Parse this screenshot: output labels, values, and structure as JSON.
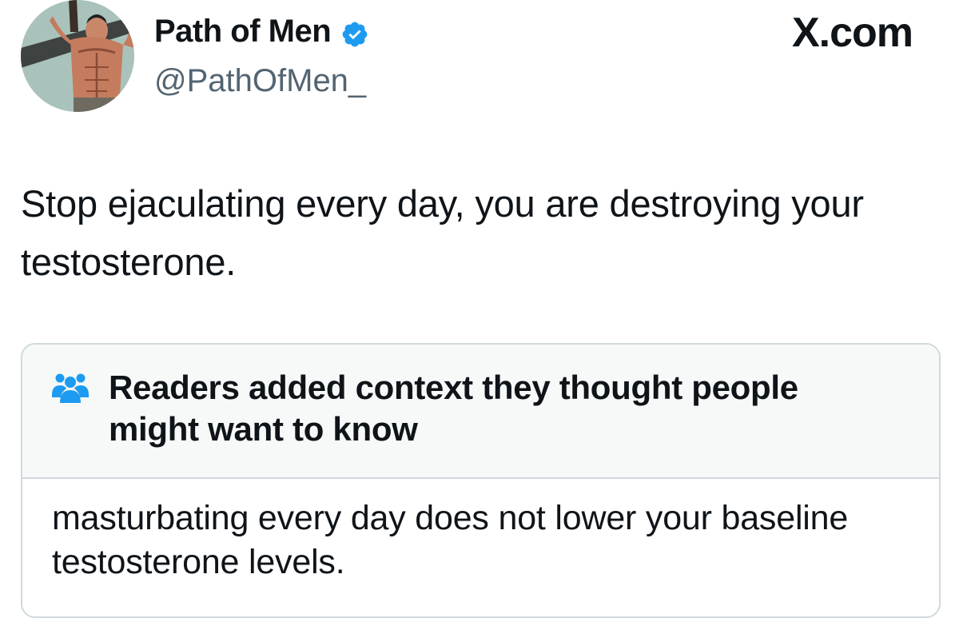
{
  "author": {
    "display_name": "Path of Men",
    "handle": "@PathOfMen_",
    "avatar_icon": "muscular-man-avatar",
    "verified_icon": "verified-badge-icon",
    "verified_color": "#1d9bf0"
  },
  "brand": {
    "label": "X.com"
  },
  "tweet": {
    "text": "Stop ejaculating every day, you are destroying your testosterone."
  },
  "community_note": {
    "icon": "readers-icon",
    "icon_color": "#1d9bf0",
    "title": "Readers added context they thought people might want to know",
    "body": "masturbating every day does not lower your baseline testosterone levels."
  }
}
